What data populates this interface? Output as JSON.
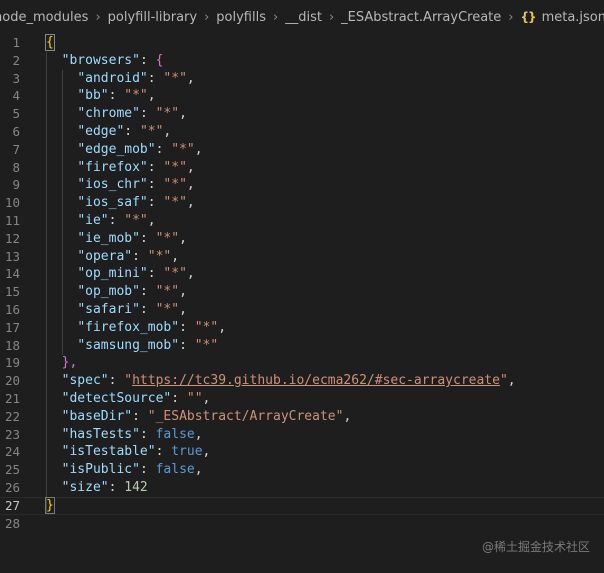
{
  "breadcrumb": {
    "items": [
      "node_modules",
      "polyfill-library",
      "polyfills",
      "__dist",
      "_ESAbstract.ArrayCreate"
    ],
    "file_icon": "{}",
    "file_icon_name": "json-file-icon",
    "file": "meta.json",
    "ellipsis": "…",
    "separator": "›"
  },
  "editor": {
    "line_numbers": [
      "1",
      "2",
      "3",
      "4",
      "5",
      "6",
      "7",
      "8",
      "9",
      "10",
      "11",
      "12",
      "13",
      "14",
      "15",
      "16",
      "17",
      "18",
      "19",
      "20",
      "21",
      "22",
      "23",
      "24",
      "25",
      "26",
      "27",
      "28"
    ],
    "open_brace": "{",
    "close_brace": "}",
    "browsers_key": "\"browsers\"",
    "browsers_open": "{",
    "browsers_close": "},",
    "browsers": [
      {
        "key": "\"android\"",
        "value": "\"*\"",
        "comma": ","
      },
      {
        "key": "\"bb\"",
        "value": "\"*\"",
        "comma": ","
      },
      {
        "key": "\"chrome\"",
        "value": "\"*\"",
        "comma": ","
      },
      {
        "key": "\"edge\"",
        "value": "\"*\"",
        "comma": ","
      },
      {
        "key": "\"edge_mob\"",
        "value": "\"*\"",
        "comma": ","
      },
      {
        "key": "\"firefox\"",
        "value": "\"*\"",
        "comma": ","
      },
      {
        "key": "\"ios_chr\"",
        "value": "\"*\"",
        "comma": ","
      },
      {
        "key": "\"ios_saf\"",
        "value": "\"*\"",
        "comma": ","
      },
      {
        "key": "\"ie\"",
        "value": "\"*\"",
        "comma": ","
      },
      {
        "key": "\"ie_mob\"",
        "value": "\"*\"",
        "comma": ","
      },
      {
        "key": "\"opera\"",
        "value": "\"*\"",
        "comma": ","
      },
      {
        "key": "\"op_mini\"",
        "value": "\"*\"",
        "comma": ","
      },
      {
        "key": "\"op_mob\"",
        "value": "\"*\"",
        "comma": ","
      },
      {
        "key": "\"safari\"",
        "value": "\"*\"",
        "comma": ","
      },
      {
        "key": "\"firefox_mob\"",
        "value": "\"*\"",
        "comma": ","
      },
      {
        "key": "\"samsung_mob\"",
        "value": "\"*\"",
        "comma": ""
      }
    ],
    "spec_key": "\"spec\"",
    "spec_q": "\"",
    "spec_url": "https://tc39.github.io/ecma262/#sec-arraycreate",
    "detect_key": "\"detectSource\"",
    "detect_value": "\"\"",
    "basedir_key": "\"baseDir\"",
    "basedir_value": "\"_ESAbstract/ArrayCreate\"",
    "hastests_key": "\"hasTests\"",
    "hastests_value": "false",
    "istestable_key": "\"isTestable\"",
    "istestable_value": "true",
    "ispublic_key": "\"isPublic\"",
    "ispublic_value": "false",
    "size_key": "\"size\"",
    "size_value": "142",
    "colon": ": ",
    "comma": ","
  },
  "watermark": "@稀土掘金技术社区",
  "colors": {
    "background": "#1e1e1e",
    "key": "#9cdcfe",
    "string": "#ce9178",
    "boolean": "#569cd6",
    "number": "#b5cea8",
    "brace": "#ffd700",
    "brace_nested": "#da70d6"
  }
}
